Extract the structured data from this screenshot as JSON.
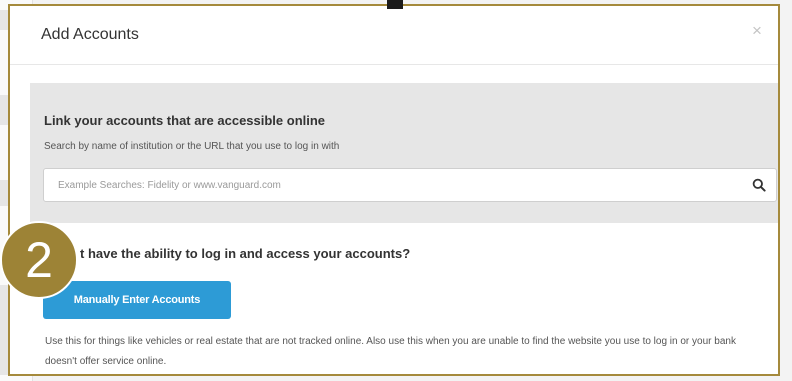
{
  "modal": {
    "title": "Add Accounts",
    "close_label": "×"
  },
  "link_section": {
    "heading": "Link your accounts that are accessible online",
    "subtext": "Search by name of institution or the URL that you use to log in with",
    "search_placeholder": "Example Searches: Fidelity or www.vanguard.com",
    "search_value": "",
    "search_icon": "search-icon"
  },
  "manual_section": {
    "heading": "t have the ability to log in and access your accounts?",
    "button_label": "Manually Enter Accounts",
    "description": "Use this for things like vehicles or real estate that are not tracked online. Also use this when you are unable to find the website you use to log in or your bank doesn't offer service online."
  },
  "step_badge": {
    "number": "2",
    "color": "#9d8336"
  },
  "colors": {
    "accent_button": "#2d9bd6",
    "frame": "#a58a3c",
    "section_bg": "#e6e6e6"
  }
}
